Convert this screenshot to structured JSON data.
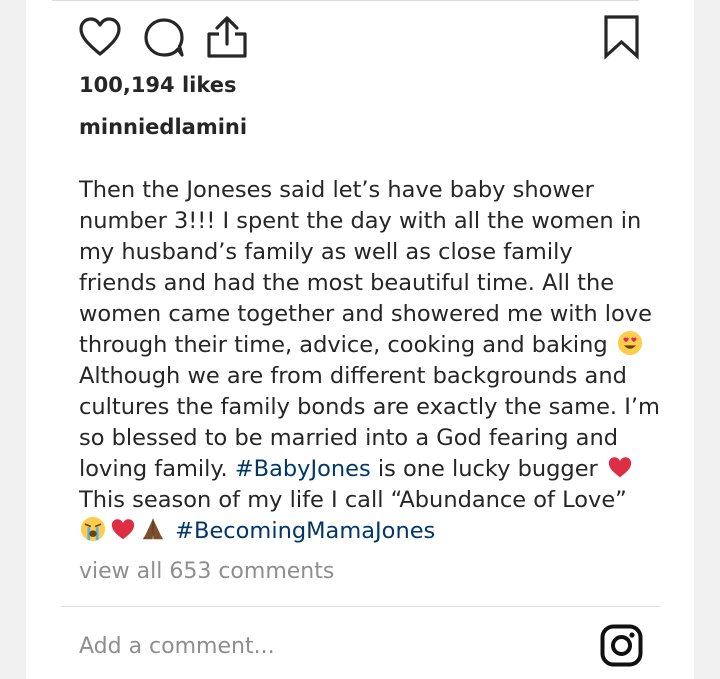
{
  "post": {
    "likes_text": "100,194 likes",
    "username": "minniedlamini",
    "caption": {
      "line1": "Then the Joneses said let’s have baby shower",
      "line2": "number 3!!! I spent the day with all the women in",
      "line3": "my husband’s family as well as close family",
      "line4": "friends and had the most beautiful time. All the",
      "line5": "women came together and showered me with love",
      "line6": "through their time, advice, cooking and baking",
      "line7": "Although we are from different backgrounds and",
      "line8": "cultures the family bonds are exactly the same. I’m",
      "line9": "so blessed to be married into a God fearing and",
      "line10_pre": "loving family. ",
      "hashtag1": "#BabyJones",
      "line10_post": " is one lucky bugger",
      "line11": "This season of my life I call “Abundance of Love”",
      "hashtag2": "#BecomingMamaJones"
    },
    "view_comments": "view all 653 comments",
    "comment_placeholder": "Add a comment..."
  },
  "icons": {
    "like": "heart-icon",
    "comment": "comment-bubble-icon",
    "share": "share-icon",
    "save": "bookmark-icon",
    "brand": "instagram-icon",
    "emojis": [
      "heart-eyes-emoji",
      "red-heart-emoji",
      "crying-face-emoji",
      "red-heart-emoji",
      "folded-hands-emoji"
    ]
  },
  "colors": {
    "text": "#262626",
    "hashtag": "#00376b",
    "muted": "#8e8e8e",
    "heart": "#e0245e"
  }
}
